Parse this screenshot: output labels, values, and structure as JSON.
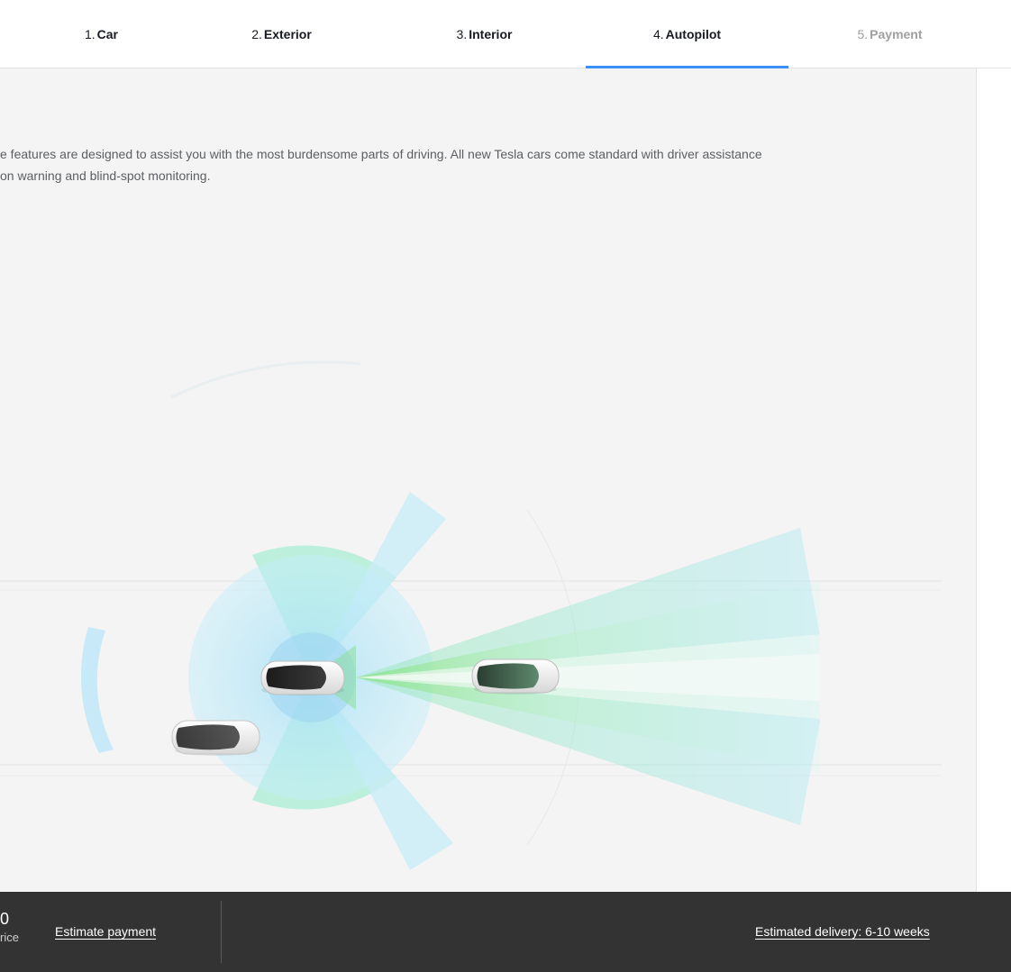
{
  "steps": [
    {
      "number": "1.",
      "label": "Car"
    },
    {
      "number": "2.",
      "label": "Exterior"
    },
    {
      "number": "3.",
      "label": "Interior"
    },
    {
      "number": "4.",
      "label": "Autopilot"
    },
    {
      "number": "5.",
      "label": "Payment"
    }
  ],
  "active_step": "Autopilot",
  "accent_color": "#3e8ef7",
  "main": {
    "description_line1": "e features are designed to assist you with the most burdensome parts of driving. All new Tesla cars come standard with driver assistance",
    "description_line2": "on warning and blind-spot monitoring."
  },
  "footer": {
    "price_value": "0",
    "price_label": "rice",
    "estimate_payment": "Estimate payment",
    "delivery": "Estimated delivery: 6-10 weeks"
  }
}
